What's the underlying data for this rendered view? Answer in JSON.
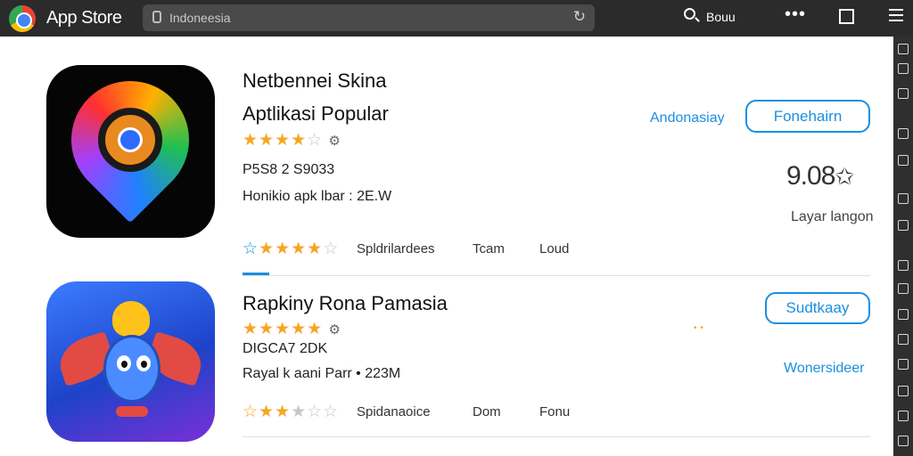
{
  "browser": {
    "title": "App Store",
    "url": "Indoneesia",
    "search_label": "Bouu"
  },
  "apps": [
    {
      "name_line1": "Netbennei Skina",
      "name_line2": "Aptlikasi Popular",
      "rating_stars": 4,
      "size_info": "P5S8 2 S9033",
      "developer_info": "Honikio apk lbar : 2E.W",
      "region_label": "Andonasiay",
      "button_label": "Fonehairn",
      "rating_value": "9.08",
      "rating_caption": "Layar langon",
      "tabs": [
        "Spldrilardees",
        "Tcam",
        "Loud"
      ],
      "tab_stars": 4
    },
    {
      "name": "Rapkiny Rona Pamasia",
      "rating_stars": 5,
      "size_info": "DIGCA7 2DK",
      "developer_info": "Rayal k aani Parr • 223M",
      "button_label": "Sudtkaay",
      "link_label": "Wonersideer",
      "tabs": [
        "Spidanaoice",
        "Dom",
        "Fonu"
      ],
      "tab_stars": 3
    }
  ],
  "colors": {
    "accent": "#1a8fe0",
    "star": "#f5a623",
    "toolbar": "#2b2b2b"
  },
  "icons": {
    "browser_logo": "chrome-logo-icon",
    "lock": "lock-icon",
    "reload": "reload-icon",
    "search": "search-icon",
    "more": "more-icon",
    "window": "window-icon",
    "menu": "menu-icon"
  }
}
